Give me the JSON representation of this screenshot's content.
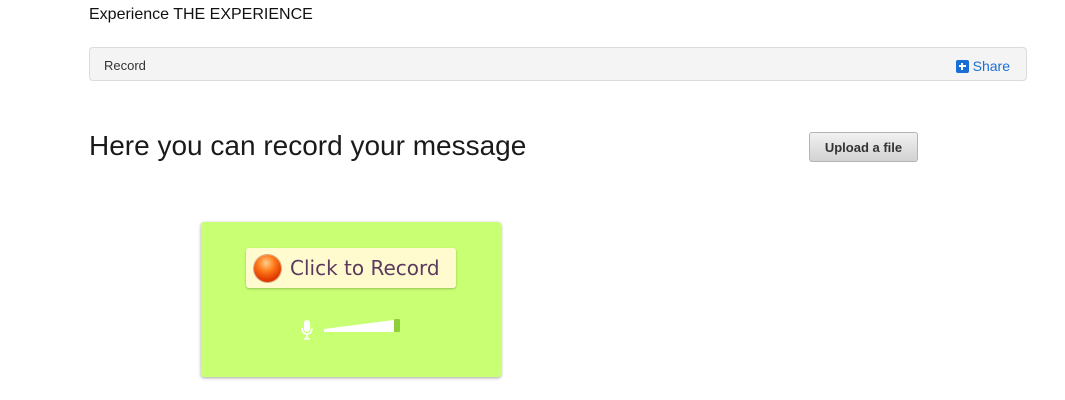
{
  "site": {
    "title": "Experience THE EXPERIENCE"
  },
  "breadcrumb": {
    "label": "Record",
    "share_label": "Share"
  },
  "main": {
    "heading": "Here you can record your message",
    "upload_label": "Upload a file"
  },
  "recorder": {
    "record_label": "Click to Record",
    "background_color": "#c9ff72",
    "button_color": "#fffbcf"
  },
  "icons": {
    "share": "plus-square-icon",
    "record": "record-dot-icon",
    "mic": "microphone-icon"
  }
}
